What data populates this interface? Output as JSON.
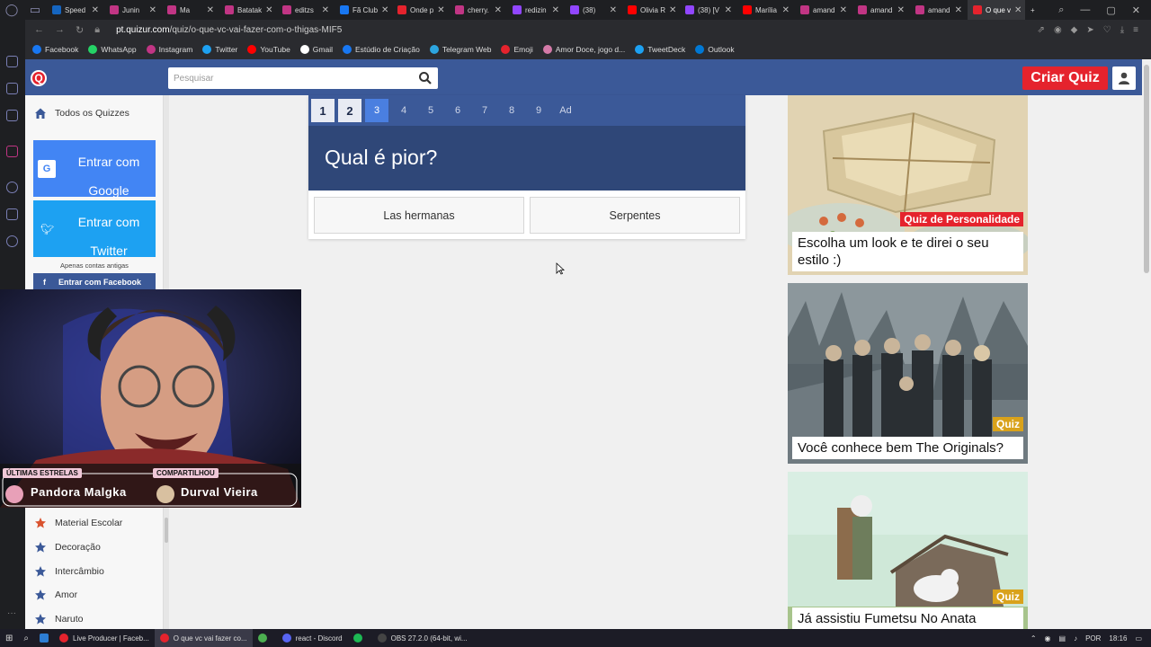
{
  "browser": {
    "tabs": [
      {
        "label": "Speed",
        "color": "#1565c0"
      },
      {
        "label": "Junin",
        "color": "#c13584"
      },
      {
        "label": "Ma",
        "color": "#c13584"
      },
      {
        "label": "Batatak",
        "color": "#c13584"
      },
      {
        "label": "editzs",
        "color": "#c13584"
      },
      {
        "label": "Fã Club",
        "color": "#1877f2"
      },
      {
        "label": "Onde p",
        "color": "#e5232d"
      },
      {
        "label": "cherry.",
        "color": "#c13584"
      },
      {
        "label": "redizin",
        "color": "#9146ff"
      },
      {
        "label": "(38)",
        "color": "#9146ff"
      },
      {
        "label": "Olivia R",
        "color": "#ff0000"
      },
      {
        "label": "(38) [V",
        "color": "#9146ff"
      },
      {
        "label": "Marília",
        "color": "#ff0000"
      },
      {
        "label": "amand",
        "color": "#c13584"
      },
      {
        "label": "amand",
        "color": "#c13584"
      },
      {
        "label": "amand",
        "color": "#c13584"
      },
      {
        "label": "O que v",
        "color": "#e5232d",
        "active": true
      }
    ],
    "url_domain": "pt.quizur.com",
    "url_path": "/quiz/o-que-vc-vai-fazer-com-o-thigas-MIF5",
    "bookmarks": [
      {
        "label": "Facebook",
        "color": "#1877f2"
      },
      {
        "label": "WhatsApp",
        "color": "#25d366"
      },
      {
        "label": "Instagram",
        "color": "#c13584"
      },
      {
        "label": "Twitter",
        "color": "#1da1f2"
      },
      {
        "label": "YouTube",
        "color": "#ff0000"
      },
      {
        "label": "Gmail",
        "color": "#ffffff"
      },
      {
        "label": "Estúdio de Criação",
        "color": "#1877f2"
      },
      {
        "label": "Telegram Web",
        "color": "#2ca5e0"
      },
      {
        "label": "Emoji",
        "color": "#e5232d"
      },
      {
        "label": "Amor Doce, jogo d...",
        "color": "#d47aa8"
      },
      {
        "label": "TweetDeck",
        "color": "#1da1f2"
      },
      {
        "label": "Outlook",
        "color": "#0078d4"
      }
    ]
  },
  "header": {
    "search_placeholder": "Pesquisar",
    "create_quiz": "Criar Quiz"
  },
  "sidebar": {
    "all_quizzes": "Todos os Quizzes",
    "google_line1": "Entrar com",
    "google_line2": "Google",
    "twitter_line1": "Entrar com",
    "twitter_line2": "Twitter",
    "old_accounts": "Apenas contas antigas",
    "facebook": "Entrar com Facebook",
    "categories": [
      "Material Escolar",
      "Decoração",
      "Intercâmbio",
      "Amor",
      "Naruto"
    ]
  },
  "quiz": {
    "pages": [
      "1",
      "2",
      "3",
      "4",
      "5",
      "6",
      "7",
      "8",
      "9",
      "Ad"
    ],
    "current_page": 3,
    "question": "Qual é pior?",
    "answers": [
      "Las hermanas",
      "Serpentes"
    ]
  },
  "recommendations": [
    {
      "badge": "Quiz de Personalidade",
      "badge_color": "#e5232d",
      "title": "Escolha um look e te direi o seu estilo :)"
    },
    {
      "badge": "Quiz",
      "badge_color": "#d9a21b",
      "title": "Você conhece bem The Originals?"
    },
    {
      "badge": "Quiz",
      "badge_color": "#d9a21b",
      "title": "Já assistiu Fumetsu No Anata"
    }
  ],
  "stream_overlay": {
    "recent_label": "ÚLTIMAS ESTRELAS",
    "recent_name": "Pandora Malgka",
    "shared_label": "COMPARTILHOU",
    "shared_name": "Durval Vieira"
  },
  "taskbar": {
    "items": [
      {
        "label": "Live Producer | Faceb...",
        "color": "#e5232d"
      },
      {
        "label": "O que vc vai fazer co...",
        "color": "#e5232d",
        "active": true
      },
      {
        "label": "",
        "color": "#4caf50"
      },
      {
        "label": "react - Discord",
        "color": "#5865f2"
      },
      {
        "label": "",
        "color": "#1db954"
      },
      {
        "label": "OBS 27.2.0 (64-bit, wi...",
        "color": "#444444"
      }
    ],
    "lang": "POR",
    "time": "18:16"
  }
}
